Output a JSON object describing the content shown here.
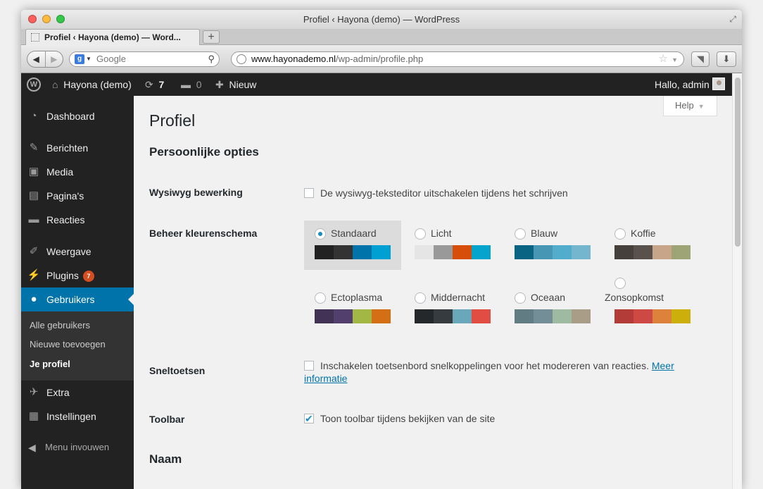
{
  "window": {
    "title": "Profiel ‹ Hayona (demo) — WordPress"
  },
  "tab": {
    "label": "Profiel ‹ Hayona (demo) — Word..."
  },
  "browser": {
    "search_placeholder": "Google",
    "url_host": "www.hayonademo.nl",
    "url_path": "/wp-admin/profile.php"
  },
  "adminbar": {
    "site_name": "Hayona (demo)",
    "updates": "7",
    "comments": "0",
    "new_label": "Nieuw",
    "greeting": "Hallo, admin"
  },
  "sidebar": {
    "items": [
      {
        "label": "Dashboard",
        "icon": "dashboard-icon"
      },
      {
        "label": "Berichten",
        "icon": "pin-icon"
      },
      {
        "label": "Media",
        "icon": "media-icon"
      },
      {
        "label": "Pagina's",
        "icon": "pages-icon"
      },
      {
        "label": "Reacties",
        "icon": "comment-icon"
      },
      {
        "label": "Weergave",
        "icon": "brush-icon"
      },
      {
        "label": "Plugins",
        "icon": "plugin-icon",
        "badge": "7"
      },
      {
        "label": "Gebruikers",
        "icon": "user-icon"
      },
      {
        "label": "Extra",
        "icon": "wrench-icon"
      },
      {
        "label": "Instellingen",
        "icon": "settings-icon"
      }
    ],
    "submenu": [
      "Alle gebruikers",
      "Nieuwe toevoegen",
      "Je profiel"
    ],
    "collapse": "Menu invouwen"
  },
  "page": {
    "help": "Help",
    "title": "Profiel",
    "section_personal": "Persoonlijke opties",
    "wysiwyg_label": "Wysiwyg bewerking",
    "wysiwyg_text": "De wysiwyg-teksteditor uitschakelen tijdens het schrijven",
    "scheme_label": "Beheer kleurenschema",
    "shortcuts_label": "Sneltoetsen",
    "shortcuts_text": "Inschakelen toetsenbord snelkoppelingen voor het modereren van reacties.",
    "shortcuts_link_1": "Meer",
    "shortcuts_link_2": "informatie",
    "toolbar_label": "Toolbar",
    "toolbar_text": "Toon toolbar tijdens bekijken van de site",
    "section_name": "Naam"
  },
  "schemes": [
    {
      "name": "Standaard",
      "colors": [
        "#222222",
        "#333333",
        "#0073aa",
        "#00a0d2"
      ],
      "selected": true
    },
    {
      "name": "Licht",
      "colors": [
        "#e5e5e5",
        "#999999",
        "#d64e07",
        "#04a4cc"
      ]
    },
    {
      "name": "Blauw",
      "colors": [
        "#096484",
        "#4796b3",
        "#52accc",
        "#74B6CE"
      ]
    },
    {
      "name": "Koffie",
      "colors": [
        "#46403c",
        "#59524c",
        "#c7a589",
        "#9ea476"
      ]
    },
    {
      "name": "Ectoplasma",
      "colors": [
        "#413256",
        "#523f6d",
        "#a3b745",
        "#d46f15"
      ]
    },
    {
      "name": "Middernacht",
      "colors": [
        "#25282b",
        "#363b3f",
        "#69a8bb",
        "#e14d43"
      ]
    },
    {
      "name": "Oceaan",
      "colors": [
        "#627c83",
        "#738e96",
        "#9ebaa0",
        "#aa9d88"
      ]
    },
    {
      "name": "Zonsopkomst",
      "colors": [
        "#b43c38",
        "#cf4944",
        "#dd823b",
        "#ccaf0b"
      ]
    }
  ],
  "checkboxes": {
    "wysiwyg": false,
    "shortcuts": false,
    "toolbar": true
  }
}
